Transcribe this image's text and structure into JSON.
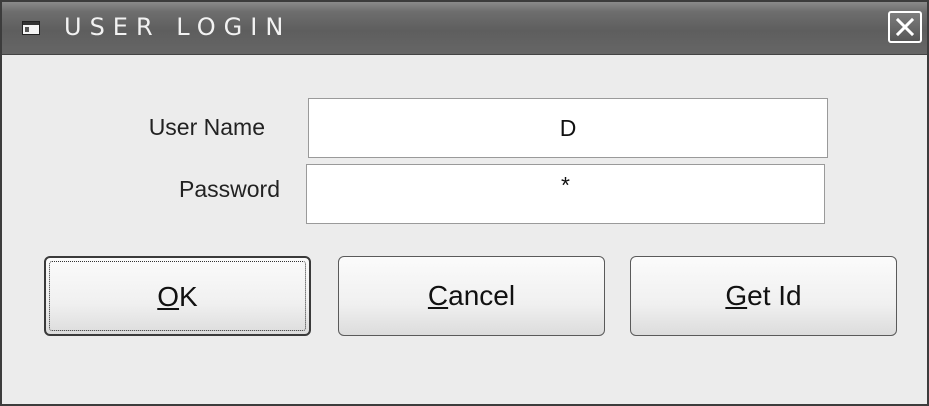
{
  "window": {
    "title": "USER LOGIN",
    "close_label": "Close"
  },
  "form": {
    "username_label": "User Name",
    "username_value": "D",
    "password_label": "Password",
    "password_value": "*"
  },
  "buttons": {
    "ok": {
      "mnemonic": "O",
      "rest": "K"
    },
    "cancel": {
      "mnemonic": "C",
      "rest": "ancel"
    },
    "get_id": {
      "mnemonic": "G",
      "rest": "et Id"
    }
  },
  "icons": {
    "app": "window-icon",
    "close": "close-icon"
  },
  "colors": {
    "titlebar": "#5e5e5e",
    "dialog_bg": "#ececec",
    "field_bg": "#ffffff"
  }
}
